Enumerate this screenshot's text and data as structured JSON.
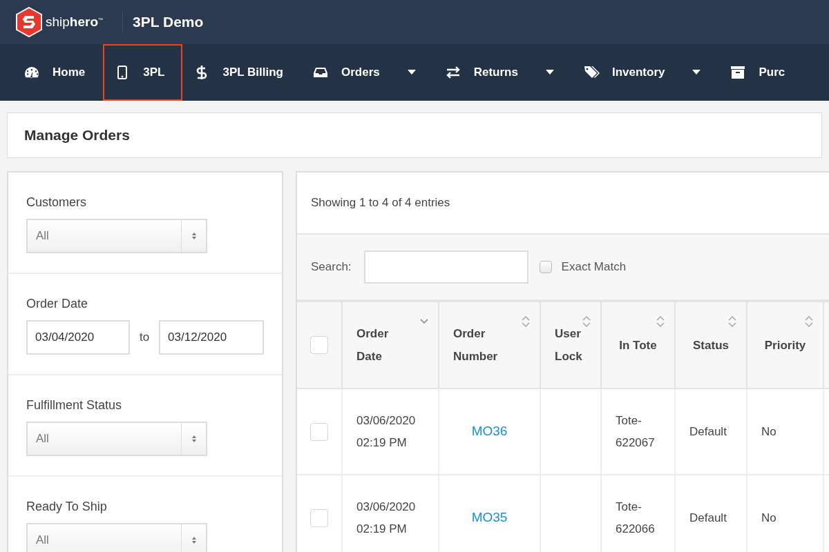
{
  "header": {
    "brand": "ship**hero**",
    "trademark": "™",
    "title": "3PL Demo"
  },
  "nav": [
    {
      "label": "Home",
      "dropdown": false,
      "highlighted": false
    },
    {
      "label": "3PL",
      "dropdown": false,
      "highlighted": true
    },
    {
      "label": "3PL Billing",
      "dropdown": false,
      "highlighted": false
    },
    {
      "label": "Orders",
      "dropdown": true,
      "highlighted": false
    },
    {
      "label": "Returns",
      "dropdown": true,
      "highlighted": false
    },
    {
      "label": "Inventory",
      "dropdown": true,
      "highlighted": false
    },
    {
      "label": "Purc",
      "dropdown": false,
      "highlighted": false
    }
  ],
  "page_title": "Manage Orders",
  "filters": [
    {
      "kind": "select",
      "label": "Customers",
      "value": "All"
    },
    {
      "kind": "date_range",
      "label": "Order Date",
      "from": "03/04/2020",
      "separator": "to",
      "to": "03/12/2020"
    },
    {
      "kind": "select",
      "label": "Fulfillment Status",
      "value": "All"
    },
    {
      "kind": "select",
      "label": "Ready To Ship",
      "value": "All"
    }
  ],
  "summary": "Showing 1 to 4 of 4 entries",
  "search": {
    "label": "Search:",
    "exact_match": {
      "label": "Exact Match",
      "checked": false
    }
  },
  "table": {
    "select_all": false,
    "columns": [
      {
        "label": "Order Date",
        "sorted": true
      },
      {
        "label": "Order Number",
        "sorted": false
      },
      {
        "label": "User Lock",
        "sorted": false
      },
      {
        "label": "In Tote",
        "sorted": false
      },
      {
        "label": "Status",
        "sorted": false
      },
      {
        "label": "Priority",
        "sorted": false
      }
    ],
    "rows": [
      {
        "checked": false,
        "order_date": "03/06/2020 02:19 PM",
        "order_number": "MO36",
        "in_tote": "Tote-622067",
        "status": "Default",
        "priority": "No"
      },
      {
        "checked": false,
        "order_date": "03/06/2020 02:19 PM",
        "order_number": "MO35",
        "in_tote": "Tote-622066",
        "status": "Default",
        "priority": "No"
      }
    ]
  }
}
